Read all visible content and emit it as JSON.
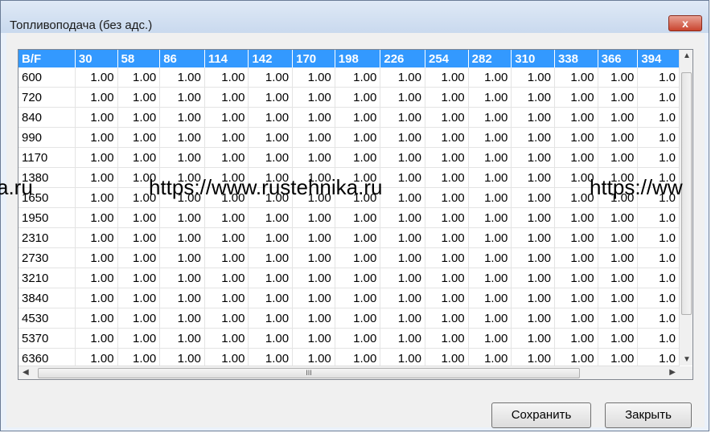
{
  "window": {
    "title": "Топливоподача (без адс.)",
    "close_label": "x"
  },
  "table": {
    "corner_header": "B/F",
    "columns": [
      "30",
      "58",
      "86",
      "114",
      "142",
      "170",
      "198",
      "226",
      "254",
      "282",
      "310",
      "338",
      "366",
      "394"
    ],
    "rows": [
      {
        "label": "600",
        "cells": [
          "1.00",
          "1.00",
          "1.00",
          "1.00",
          "1.00",
          "1.00",
          "1.00",
          "1.00",
          "1.00",
          "1.00",
          "1.00",
          "1.00",
          "1.00",
          "1.0"
        ]
      },
      {
        "label": "720",
        "cells": [
          "1.00",
          "1.00",
          "1.00",
          "1.00",
          "1.00",
          "1.00",
          "1.00",
          "1.00",
          "1.00",
          "1.00",
          "1.00",
          "1.00",
          "1.00",
          "1.0"
        ]
      },
      {
        "label": "840",
        "cells": [
          "1.00",
          "1.00",
          "1.00",
          "1.00",
          "1.00",
          "1.00",
          "1.00",
          "1.00",
          "1.00",
          "1.00",
          "1.00",
          "1.00",
          "1.00",
          "1.0"
        ]
      },
      {
        "label": "990",
        "cells": [
          "1.00",
          "1.00",
          "1.00",
          "1.00",
          "1.00",
          "1.00",
          "1.00",
          "1.00",
          "1.00",
          "1.00",
          "1.00",
          "1.00",
          "1.00",
          "1.0"
        ]
      },
      {
        "label": "1170",
        "cells": [
          "1.00",
          "1.00",
          "1.00",
          "1.00",
          "1.00",
          "1.00",
          "1.00",
          "1.00",
          "1.00",
          "1.00",
          "1.00",
          "1.00",
          "1.00",
          "1.0"
        ]
      },
      {
        "label": "1380",
        "cells": [
          "1.00",
          "1.00",
          "1.00",
          "1.00",
          "1.00",
          "1.00",
          "1.00",
          "1.00",
          "1.00",
          "1.00",
          "1.00",
          "1.00",
          "1.00",
          "1.0"
        ]
      },
      {
        "label": "1650",
        "cells": [
          "1.00",
          "1.00",
          "1.00",
          "1.00",
          "1.00",
          "1.00",
          "1.00",
          "1.00",
          "1.00",
          "1.00",
          "1.00",
          "1.00",
          "1.00",
          "1.0"
        ]
      },
      {
        "label": "1950",
        "cells": [
          "1.00",
          "1.00",
          "1.00",
          "1.00",
          "1.00",
          "1.00",
          "1.00",
          "1.00",
          "1.00",
          "1.00",
          "1.00",
          "1.00",
          "1.00",
          "1.0"
        ]
      },
      {
        "label": "2310",
        "cells": [
          "1.00",
          "1.00",
          "1.00",
          "1.00",
          "1.00",
          "1.00",
          "1.00",
          "1.00",
          "1.00",
          "1.00",
          "1.00",
          "1.00",
          "1.00",
          "1.0"
        ]
      },
      {
        "label": "2730",
        "cells": [
          "1.00",
          "1.00",
          "1.00",
          "1.00",
          "1.00",
          "1.00",
          "1.00",
          "1.00",
          "1.00",
          "1.00",
          "1.00",
          "1.00",
          "1.00",
          "1.0"
        ]
      },
      {
        "label": "3210",
        "cells": [
          "1.00",
          "1.00",
          "1.00",
          "1.00",
          "1.00",
          "1.00",
          "1.00",
          "1.00",
          "1.00",
          "1.00",
          "1.00",
          "1.00",
          "1.00",
          "1.0"
        ]
      },
      {
        "label": "3840",
        "cells": [
          "1.00",
          "1.00",
          "1.00",
          "1.00",
          "1.00",
          "1.00",
          "1.00",
          "1.00",
          "1.00",
          "1.00",
          "1.00",
          "1.00",
          "1.00",
          "1.0"
        ]
      },
      {
        "label": "4530",
        "cells": [
          "1.00",
          "1.00",
          "1.00",
          "1.00",
          "1.00",
          "1.00",
          "1.00",
          "1.00",
          "1.00",
          "1.00",
          "1.00",
          "1.00",
          "1.00",
          "1.0"
        ]
      },
      {
        "label": "5370",
        "cells": [
          "1.00",
          "1.00",
          "1.00",
          "1.00",
          "1.00",
          "1.00",
          "1.00",
          "1.00",
          "1.00",
          "1.00",
          "1.00",
          "1.00",
          "1.00",
          "1.0"
        ]
      },
      {
        "label": "6360",
        "cells": [
          "1.00",
          "1.00",
          "1.00",
          "1.00",
          "1.00",
          "1.00",
          "1.00",
          "1.00",
          "1.00",
          "1.00",
          "1.00",
          "1.00",
          "1.00",
          "1.0"
        ]
      }
    ]
  },
  "scrollbars": {
    "hthumb_grip": "III"
  },
  "buttons": {
    "save": "Сохранить",
    "close": "Закрыть"
  },
  "watermark": {
    "text_a": "a.ru",
    "text_b": "https://www.rustehnika.ru",
    "text_c": "https://ww"
  }
}
